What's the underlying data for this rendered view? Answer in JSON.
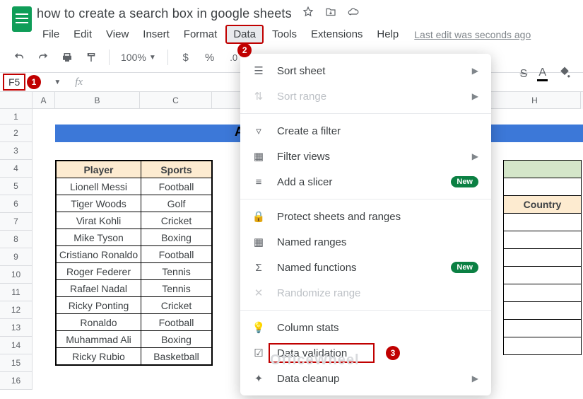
{
  "doc": {
    "name": "how to create a search box in google sheets",
    "last_edit": "Last edit was seconds ago"
  },
  "menus": [
    "File",
    "Edit",
    "View",
    "Insert",
    "Format",
    "Data",
    "Tools",
    "Extensions",
    "Help"
  ],
  "toolbar": {
    "zoom": "100%",
    "currency": "$",
    "percent": "%",
    "dec": ".0"
  },
  "name_box": "F5",
  "fx": "fx",
  "columns": [
    "A",
    "B",
    "C",
    "H"
  ],
  "rows": [
    "1",
    "2",
    "3",
    "4",
    "5",
    "6",
    "7",
    "8",
    "9",
    "10",
    "11",
    "12",
    "13",
    "14",
    "15",
    "16"
  ],
  "title_strip_letter": "A",
  "table": {
    "headers": {
      "player": "Player",
      "sports": "Sports"
    },
    "rows": [
      {
        "player": "Lionell Messi",
        "sport": "Football"
      },
      {
        "player": "Tiger Woods",
        "sport": "Golf"
      },
      {
        "player": "Virat Kohli",
        "sport": "Cricket"
      },
      {
        "player": "Mike Tyson",
        "sport": "Boxing"
      },
      {
        "player": "Cristiano Ronaldo",
        "sport": "Football"
      },
      {
        "player": "Roger Federer",
        "sport": "Tennis"
      },
      {
        "player": "Rafael Nadal",
        "sport": "Tennis"
      },
      {
        "player": "Ricky Ponting",
        "sport": "Cricket"
      },
      {
        "player": "Ronaldo",
        "sport": "Football"
      },
      {
        "player": "Muhammad Ali",
        "sport": "Boxing"
      },
      {
        "player": "Ricky Rubio",
        "sport": "Basketball"
      }
    ]
  },
  "country_header": "Country",
  "dropdown": {
    "sort_sheet": "Sort sheet",
    "sort_range": "Sort range",
    "create_filter": "Create a filter",
    "filter_views": "Filter views",
    "add_slicer": "Add a slicer",
    "protect": "Protect sheets and ranges",
    "named_ranges": "Named ranges",
    "named_functions": "Named functions",
    "randomize": "Randomize range",
    "column_stats": "Column stats",
    "data_validation": "Data validation",
    "data_cleanup": "Data cleanup",
    "new_label": "New"
  },
  "badges": {
    "one": "1",
    "two": "2",
    "three": "3"
  },
  "watermark": "OfficeWheel"
}
